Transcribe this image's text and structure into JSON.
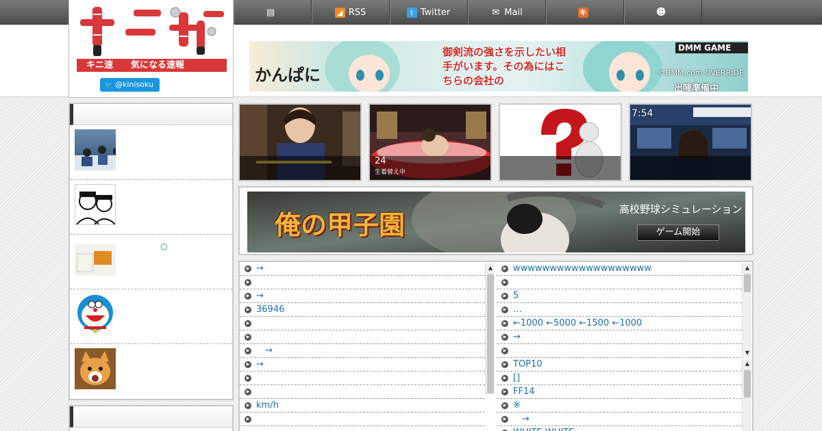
{
  "header": {
    "logo_caption": "キニ速　　気になる速報",
    "twitter_handle": "@kinisoku",
    "nav": [
      {
        "icon": "document-icon",
        "label": ""
      },
      {
        "icon": "rss-icon",
        "label": "RSS"
      },
      {
        "icon": "twitter-icon",
        "label": "Twitter"
      },
      {
        "icon": "mail-icon",
        "label": "Mail"
      },
      {
        "icon": "hatena-icon",
        "label": ""
      },
      {
        "icon": "smiley-icon",
        "label": ""
      }
    ]
  },
  "top_banner": {
    "brand": "DMM GAME",
    "game_name": "かんぱに",
    "copy": "御剣流の強さを示したい相手がいます。その為にはこちらの会社の",
    "credit": "©DMM.com OVERRIDE",
    "footer": "出陣準備中"
  },
  "sidebar": {
    "items": [
      {
        "text": ""
      },
      {
        "text": ""
      },
      {
        "text": "○"
      },
      {
        "text": ""
      },
      {
        "text": ""
      }
    ]
  },
  "thumbnails": [
    {
      "number": "",
      "sub": "",
      "time": ""
    },
    {
      "number": "24",
      "sub": "生着替え中",
      "time": ""
    },
    {
      "number": "",
      "sub": "",
      "time": ""
    },
    {
      "number": "",
      "sub": "",
      "time": "7:54"
    }
  ],
  "game_banner": {
    "title": "俺の甲子園",
    "subtitle": "高校野球シミュレーション",
    "button": "ゲーム開始"
  },
  "feeds": {
    "left": [
      "→",
      "",
      "→",
      "36946",
      "",
      "",
      "　→",
      "→",
      "",
      "",
      "km/h",
      ""
    ],
    "right_top": [
      "wwwwwwwwwwwwwwwwwww",
      "",
      "5",
      "…",
      "←1000 ←5000 ←1500 ←1000",
      "→",
      ""
    ],
    "right_bottom": [
      "TOP10",
      "[]",
      "FF14",
      "※",
      "　→",
      "WHITE WHITE"
    ]
  },
  "colors": {
    "link": "#1a6ea8",
    "nav_bar": "#5a5a5a",
    "accent_red": "#d8383a",
    "twitter": "#1b95e0"
  }
}
